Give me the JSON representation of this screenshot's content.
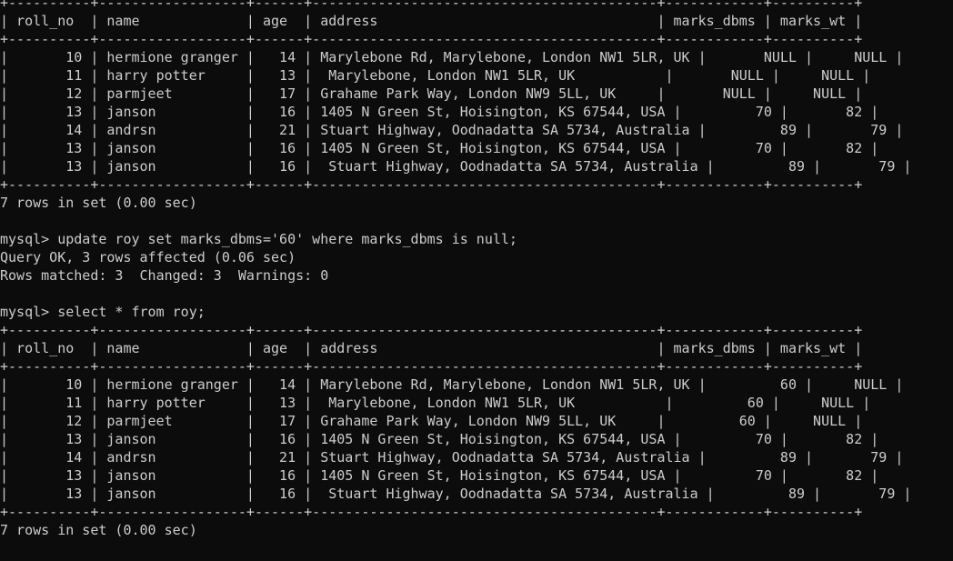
{
  "terminal": {
    "lines": [
      "+----------+------------------+------+------------------------------------------+------------+----------+",
      "| roll_no  | name             | age  | address                                  | marks_dbms | marks_wt |",
      "+----------+------------------+------+------------------------------------------+------------+----------+",
      "|       10 | hermione granger |   14 | Marylebone Rd, Marylebone, London NW1 5LR, UK |       NULL |     NULL |",
      "|       11 | harry potter     |   13 |  Marylebone, London NW1 5LR, UK           |       NULL |     NULL |",
      "|       12 | parmjeet         |   17 | Grahame Park Way, London NW9 5LL, UK     |       NULL |     NULL |",
      "|       13 | janson           |   16 | 1405 N Green St, Hoisington, KS 67544, USA |         70 |       82 |",
      "|       14 | andrsn           |   21 | Stuart Highway, Oodnadatta SA 5734, Australia |         89 |       79 |",
      "|       13 | janson           |   16 | 1405 N Green St, Hoisington, KS 67544, USA |         70 |       82 |",
      "|       13 | janson           |   16 |  Stuart Highway, Oodnadatta SA 5734, Australia |         89 |       79 |",
      "+----------+------------------+------+------------------------------------------+------------+----------+",
      "7 rows in set (0.00 sec)",
      "",
      "mysql> update roy set marks_dbms='60' where marks_dbms is null;",
      "Query OK, 3 rows affected (0.06 sec)",
      "Rows matched: 3  Changed: 3  Warnings: 0",
      "",
      "mysql> select * from roy;",
      "+----------+------------------+------+------------------------------------------+------------+----------+",
      "| roll_no  | name             | age  | address                                  | marks_dbms | marks_wt |",
      "+----------+------------------+------+------------------------------------------+------------+----------+",
      "|       10 | hermione granger |   14 | Marylebone Rd, Marylebone, London NW1 5LR, UK |         60 |     NULL |",
      "|       11 | harry potter     |   13 |  Marylebone, London NW1 5LR, UK           |         60 |     NULL |",
      "|       12 | parmjeet         |   17 | Grahame Park Way, London NW9 5LL, UK     |         60 |     NULL |",
      "|       13 | janson           |   16 | 1405 N Green St, Hoisington, KS 67544, USA |         70 |       82 |",
      "|       14 | andrsn           |   21 | Stuart Highway, Oodnadatta SA 5734, Australia |         89 |       79 |",
      "|       13 | janson           |   16 | 1405 N Green St, Hoisington, KS 67544, USA |         70 |       82 |",
      "|       13 | janson           |   16 |  Stuart Highway, Oodnadatta SA 5734, Australia |         89 |       79 |",
      "+----------+------------------+------+------------------------------------------+------------+----------+",
      "7 rows in set (0.00 sec)",
      ""
    ]
  }
}
